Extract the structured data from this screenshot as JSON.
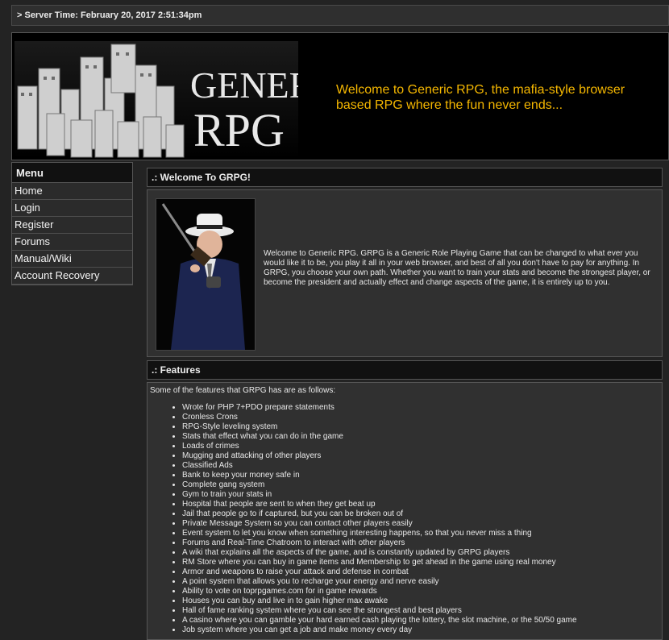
{
  "server_time": "> Server Time: February 20, 2017 2:51:34pm",
  "banner": {
    "logo_line1": "GENERIC",
    "logo_line2": "RPG",
    "welcome": "Welcome to Generic RPG, the mafia-style browser based RPG where the fun never ends..."
  },
  "menu": {
    "title": "Menu",
    "items": [
      "Home",
      "Login",
      "Register",
      "Forums",
      "Manual/Wiki",
      "Account Recovery"
    ]
  },
  "welcome_panel": {
    "title": ".: Welcome To GRPG!",
    "text": "Welcome to Generic RPG. GRPG is a Generic Role Playing Game that can be changed to what ever you would like it to be, you play it all in your web browser, and best of all you don't have to pay for anything. In GRPG, you choose your own path. Whether you want to train your stats and become the strongest player, or become the president and actually effect and change aspects of the game, it is entirely up to you."
  },
  "features_panel": {
    "title": ".: Features",
    "intro": "Some of the features that GRPG has are as follows:",
    "items": [
      "Wrote for PHP 7+PDO prepare statements",
      "Cronless Crons",
      "RPG-Style leveling system",
      "Stats that effect what you can do in the game",
      "Loads of crimes",
      "Mugging and attacking of other players",
      "Classified Ads",
      "Bank to keep your money safe in",
      "Complete gang system",
      "Gym to train your stats in",
      "Hospital that people are sent to when they get beat up",
      "Jail that people go to if captured, but you can be broken out of",
      "Private Message System so you can contact other players easily",
      "Event system to let you know when something interesting happens, so that you never miss a thing",
      "Forums and Real-Time Chatroom to interact with other players",
      "A wiki that explains all the aspects of the game, and is constantly updated by GRPG players",
      "RM Store where you can buy in game items and Membership to get ahead in the game using real money",
      "Armor and weapons to raise your attack and defense in combat",
      "A point system that allows you to recharge your energy and nerve easily",
      "Ability to vote on toprpgames.com for in game rewards",
      "Houses you can buy and live in to gain higher max awake",
      "Hall of fame ranking system where you can see the strongest and best players",
      "A casino where you can gamble your hard earned cash playing the lottery, the slot machine, or the 50/50 game",
      "Job system where you can get a job and make money every day"
    ]
  },
  "colors": {
    "background": "#232323",
    "accent": "#f5b700",
    "header_bar": "#111111"
  }
}
